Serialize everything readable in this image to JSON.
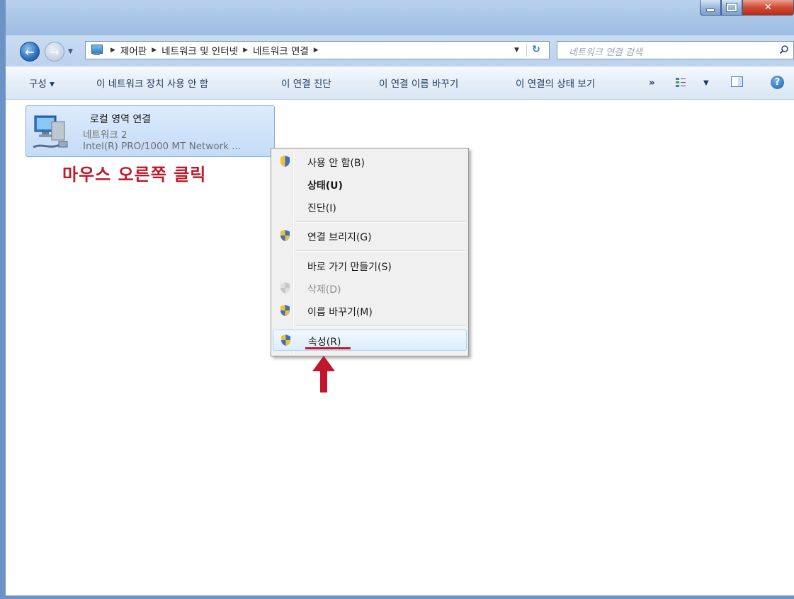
{
  "breadcrumb": [
    "제어판",
    "네트워크 및 인터넷",
    "네트워크 연결"
  ],
  "search": {
    "placeholder": "네트워크 연결 검색"
  },
  "toolbar": {
    "organize": "구성 ▾",
    "disable_device": "이 네트워크 장치 사용 안 함",
    "diagnose": "이 연결 진단",
    "rename": "이 연결 이름 바꾸기",
    "view_status": "이 연결의 상태 보기",
    "more": "»"
  },
  "connection": {
    "name": "로컬 영역 연결",
    "network": "네트워크  2",
    "adapter": "Intel(R) PRO/1000 MT Network ..."
  },
  "annotation": {
    "text": "마우스 오른쪽 클릭"
  },
  "context_menu": {
    "items": [
      {
        "label": "사용 안 함(B)",
        "shield": true
      },
      {
        "label": "상태(U)",
        "bold": true
      },
      {
        "label": "진단(I)"
      },
      {
        "label": "연결 브리지(G)",
        "shield": true
      },
      {
        "label": "바로 가기 만들기(S)"
      },
      {
        "label": "삭제(D)",
        "shield": true,
        "disabled": true
      },
      {
        "label": "이름 바꾸기(M)",
        "shield": true
      },
      {
        "label": "속성(R)",
        "shield": true,
        "highlighted": true
      }
    ]
  },
  "icons": {
    "back": "back-arrow-icon",
    "forward": "forward-arrow-icon",
    "refresh": "refresh-icon",
    "search": "search-icon",
    "help": "help-icon",
    "shield": "uac-shield-icon"
  },
  "colors": {
    "annotation": "#c0182a",
    "selection": "#c4dcf7"
  }
}
